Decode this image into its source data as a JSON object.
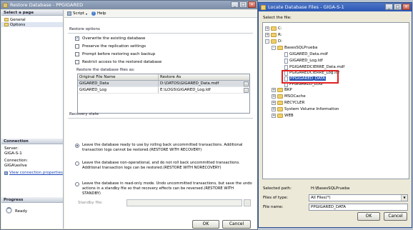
{
  "restore_window": {
    "title": "Restore Database - PPGIGARED",
    "left_pane": {
      "select_page_header": "Select a page",
      "pages": [
        {
          "label": "General"
        },
        {
          "label": "Options"
        }
      ],
      "connection_header": "Connection",
      "server_label": "Server:",
      "server_value": "GIGA-S-1",
      "connection_label": "Connection:",
      "connection_value": "GIGA\\asilva",
      "view_connection_link": "View connection properties",
      "progress_header": "Progress",
      "progress_status": "Ready"
    },
    "toolbar": {
      "script_label": "Script",
      "help_label": "Help"
    },
    "restore_options": {
      "group_title": "Restore options",
      "options": [
        {
          "label": "Overwrite the existing database",
          "checked": true
        },
        {
          "label": "Preserve the replication settings",
          "checked": false
        },
        {
          "label": "Prompt before restoring each backup",
          "checked": false
        },
        {
          "label": "Restrict access to the restored database",
          "checked": false
        }
      ]
    },
    "files_table": {
      "caption": "Restore the database files as:",
      "headers": [
        "Original File Name",
        "Restore As"
      ],
      "rows": [
        {
          "original": "GIGARED_Data",
          "restore_as": "D:\\DATOS\\GIGARED_Data.mdf"
        },
        {
          "original": "GIGARED_Log",
          "restore_as": "E:\\LOGS\\GIGARED_Log.ldf"
        }
      ]
    },
    "recovery_state": {
      "group_title": "Recovery state",
      "options": [
        {
          "label": "Leave the database ready to use by rolling back uncommitted transactions. Additional transaction logs cannot be restored.(RESTORE WITH RECOVERY)",
          "selected": true
        },
        {
          "label": "Leave the database non-operational, and do not roll back uncommitted transactions. Additional transaction logs can be restored.(RESTORE WITH NORECOVERY)",
          "selected": false
        },
        {
          "label": "Leave the database in read-only mode. Undo uncommitted transactions, but save the undo actions in a standby file so that recovery effects can be reversed.(RESTORE WITH STANDBY)",
          "selected": false
        }
      ],
      "standby_label": "Standby file:",
      "standby_value": ""
    },
    "ok_label": "OK",
    "cancel_label": "Cancel"
  },
  "locate_window": {
    "title": "Locate Database Files - GIGA-S-1",
    "tree_label": "Select the file:",
    "tree": [
      {
        "label": "C:",
        "kind": "drive",
        "expand": "+"
      },
      {
        "label": "R:",
        "kind": "drive",
        "expand": "+"
      },
      {
        "label": "D:",
        "kind": "drive",
        "expand": "-"
      },
      {
        "label": "BasesSQLPrueba",
        "kind": "folder",
        "expand": "-"
      },
      {
        "label": "GIGARED_Data.mdf",
        "kind": "file"
      },
      {
        "label": "GIGARED_Log.ldf",
        "kind": "file"
      },
      {
        "label": "PGIGAREDCIERRE_Data.mdf",
        "kind": "file"
      },
      {
        "label": "PGIGAREDCIERRE_Log.ldf",
        "kind": "file"
      },
      {
        "label": "PPGIGARED_DATA",
        "kind": "file",
        "selected": true
      },
      {
        "label": "PPGIGARED_LOG",
        "kind": "file"
      },
      {
        "label": "BKP",
        "kind": "folder",
        "expand": "+"
      },
      {
        "label": "MSOCache",
        "kind": "folder",
        "expand": "+"
      },
      {
        "label": "RECYCLER",
        "kind": "folder",
        "expand": "+"
      },
      {
        "label": "System Volume Information",
        "kind": "folder",
        "expand": "+"
      },
      {
        "label": "WEB",
        "kind": "folder",
        "expand": "+"
      }
    ],
    "selected_path_label": "Selected path:",
    "selected_path_value": "H:\\BasesSQLPrueba",
    "files_of_type_label": "Files of type:",
    "files_of_type_value": "All Files(*)",
    "file_name_label": "File name:",
    "file_name_value": "PPGIGARED_DATA",
    "ok_label": "OK",
    "cancel_label": "Cancel"
  },
  "colors": {
    "highlight_box": "#e02020",
    "selection": "#2a56b5"
  }
}
